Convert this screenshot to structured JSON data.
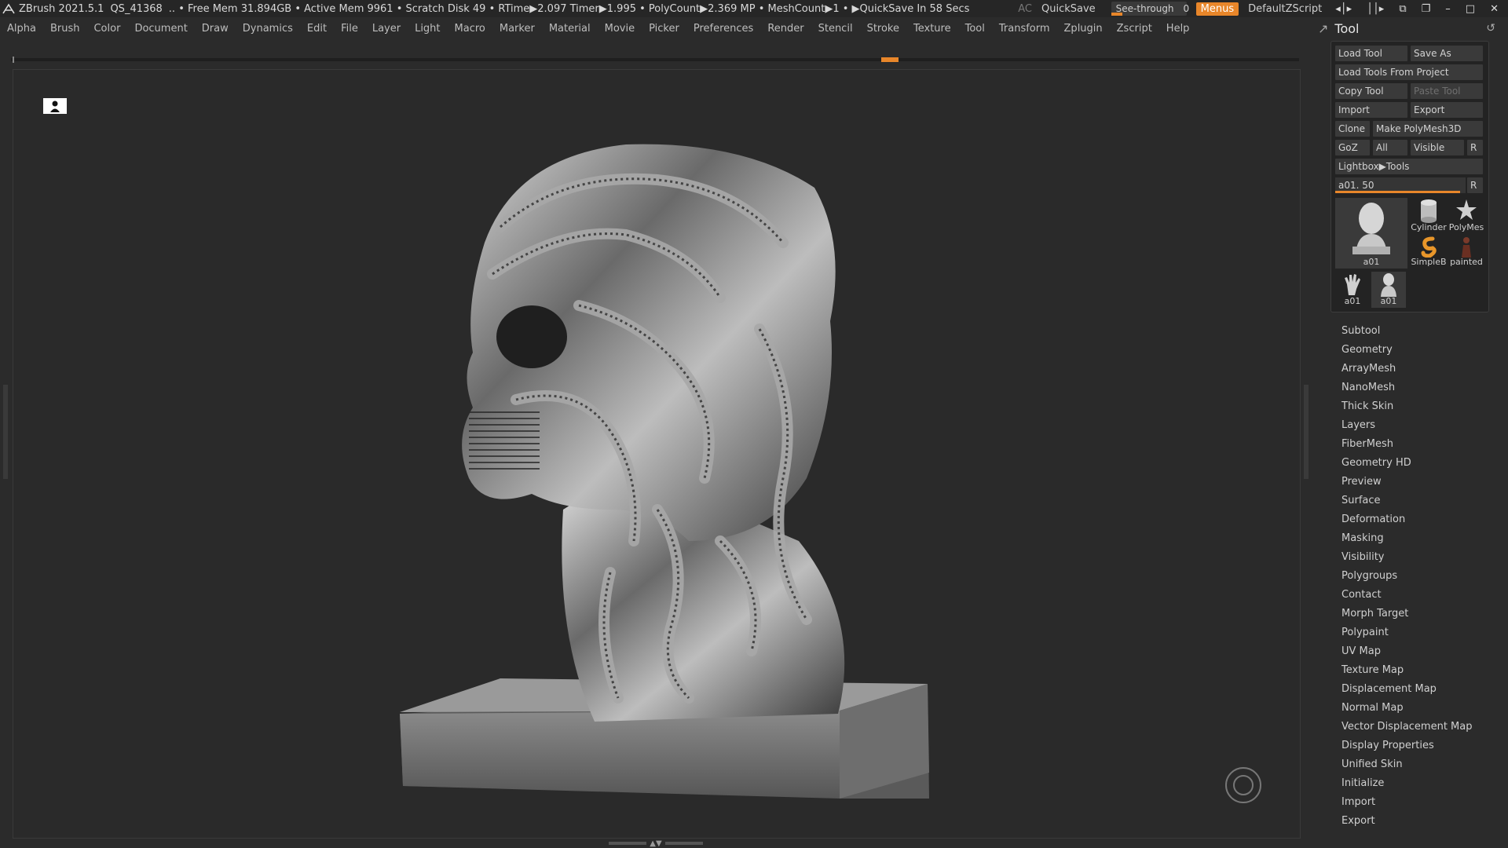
{
  "titlebar": {
    "app": "ZBrush 2021.5.1",
    "doc": "QS_41368",
    "status": ".. • Free Mem 31.894GB • Active Mem 9961 • Scratch Disk 49 •  RTime▶2.097 Timer▶1.995 • PolyCount▶2.369 MP  • MeshCount▶1  • ▶QuickSave In 58 Secs",
    "ac": "AC",
    "quicksave": "QuickSave",
    "seethrough_label": "See-through",
    "seethrough_value": "0",
    "menus": "Menus",
    "script": "DefaultZScript"
  },
  "menubar": [
    "Alpha",
    "Brush",
    "Color",
    "Document",
    "Draw",
    "Dynamics",
    "Edit",
    "File",
    "Layer",
    "Light",
    "Macro",
    "Marker",
    "Material",
    "Movie",
    "Picker",
    "Preferences",
    "Render",
    "Stencil",
    "Stroke",
    "Texture",
    "Tool",
    "Transform",
    "Zplugin",
    "Zscript",
    "Help"
  ],
  "tool_panel": {
    "title": "Tool",
    "load_tool": "Load Tool",
    "save_as": "Save As",
    "load_from_project": "Load Tools From Project",
    "copy_tool": "Copy Tool",
    "paste_tool": "Paste Tool",
    "import": "Import",
    "export": "Export",
    "clone": "Clone",
    "make_polymesh": "Make PolyMesh3D",
    "goz": "GoZ",
    "all": "All",
    "visible": "Visible",
    "r": "R",
    "lightbox_tools": "Lightbox▶Tools",
    "slider_label": "a01. 50",
    "slider_fraction": 0.96,
    "thumbs": {
      "main": "a01",
      "cylinder": "Cylinder",
      "polymesh": "PolyMes",
      "simpleb": "SimpleB",
      "painted": "painted",
      "a01_hand": "a01",
      "a01_bust": "a01"
    },
    "subpalettes": [
      "Subtool",
      "Geometry",
      "ArrayMesh",
      "NanoMesh",
      "Thick Skin",
      "Layers",
      "FiberMesh",
      "Geometry HD",
      "Preview",
      "Surface",
      "Deformation",
      "Masking",
      "Visibility",
      "Polygroups",
      "Contact",
      "Morph Target",
      "Polypaint",
      "UV Map",
      "Texture Map",
      "Displacement Map",
      "Normal Map",
      "Vector Displacement Map",
      "Display Properties",
      "Unified Skin",
      "Initialize",
      "Import",
      "Export"
    ]
  }
}
